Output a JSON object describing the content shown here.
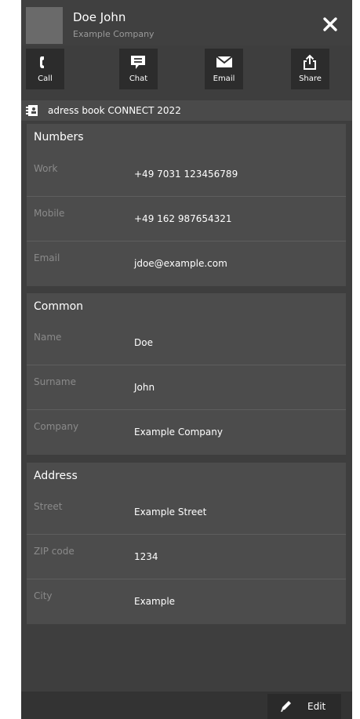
{
  "colors": {
    "panel": "#3e3e3e",
    "card": "#4c4c4c",
    "button": "#2c2c2c",
    "label": "#8a8a8a",
    "text": "#ffffff"
  },
  "contact": {
    "name": "Doe John",
    "company": "Example Company"
  },
  "actions": [
    {
      "label": "Call",
      "icon": "phone-icon"
    },
    {
      "label": "Chat",
      "icon": "chat-icon"
    },
    {
      "label": "Email",
      "icon": "envelope-icon"
    },
    {
      "label": "Share",
      "icon": "share-icon"
    }
  ],
  "address_book": {
    "label": "adress book CONNECT 2022",
    "icon": "address-book-icon"
  },
  "sections": {
    "numbers": {
      "title": "Numbers",
      "rows": [
        {
          "label": "Work",
          "value": "+49 7031 123456789"
        },
        {
          "label": "Mobile",
          "value": "+49 162 987654321"
        },
        {
          "label": "Email",
          "value": "jdoe@example.com"
        }
      ]
    },
    "common": {
      "title": "Common",
      "rows": [
        {
          "label": "Name",
          "value": "Doe"
        },
        {
          "label": "Surname",
          "value": "John"
        },
        {
          "label": "Company",
          "value": "Example Company"
        }
      ]
    },
    "address": {
      "title": "Address",
      "rows": [
        {
          "label": "Street",
          "value": "Example Street"
        },
        {
          "label": "ZIP code",
          "value": "1234"
        },
        {
          "label": "City",
          "value": "Example"
        }
      ]
    }
  },
  "footer": {
    "edit_label": "Edit",
    "icon": "pencil-icon"
  }
}
